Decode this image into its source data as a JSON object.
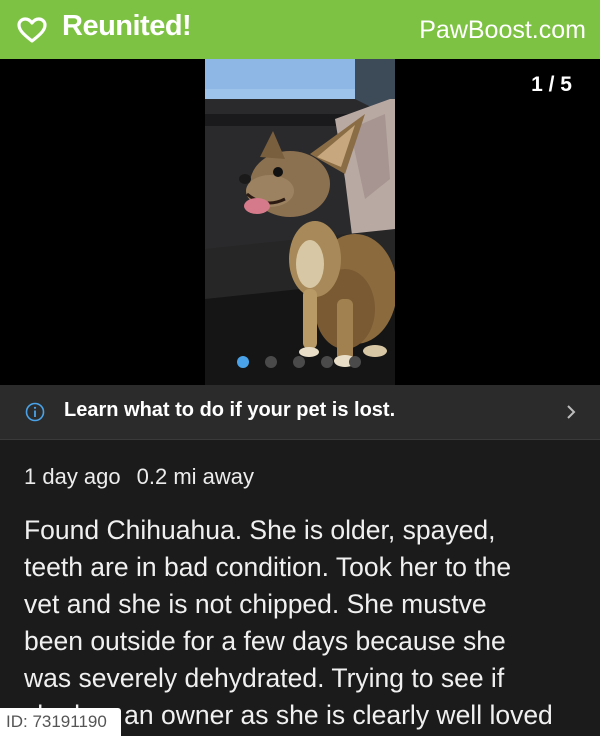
{
  "banner": {
    "title": "Reunited!",
    "brand": "PawBoost.com",
    "color": "#7dc242"
  },
  "viewer": {
    "counter": "1 / 5",
    "image_count": 5,
    "active_index": 0,
    "dot_active_color": "#4aa3e8"
  },
  "info": {
    "icon": "info-icon",
    "text": "Learn what to do if your pet is lost."
  },
  "meta": {
    "posted": "1 day ago",
    "distance": "0.2 mi away"
  },
  "description": "Found Chihuahua. She is older, spayed,\nteeth are in bad condition. Took her to the\nvet and she is not chipped. She mustve\nbeen outside for a few days because she\nwas severely dehydrated. Trying to see if\nshe has an owner as she is clearly well loved",
  "id_tag": "ID: 73191190"
}
